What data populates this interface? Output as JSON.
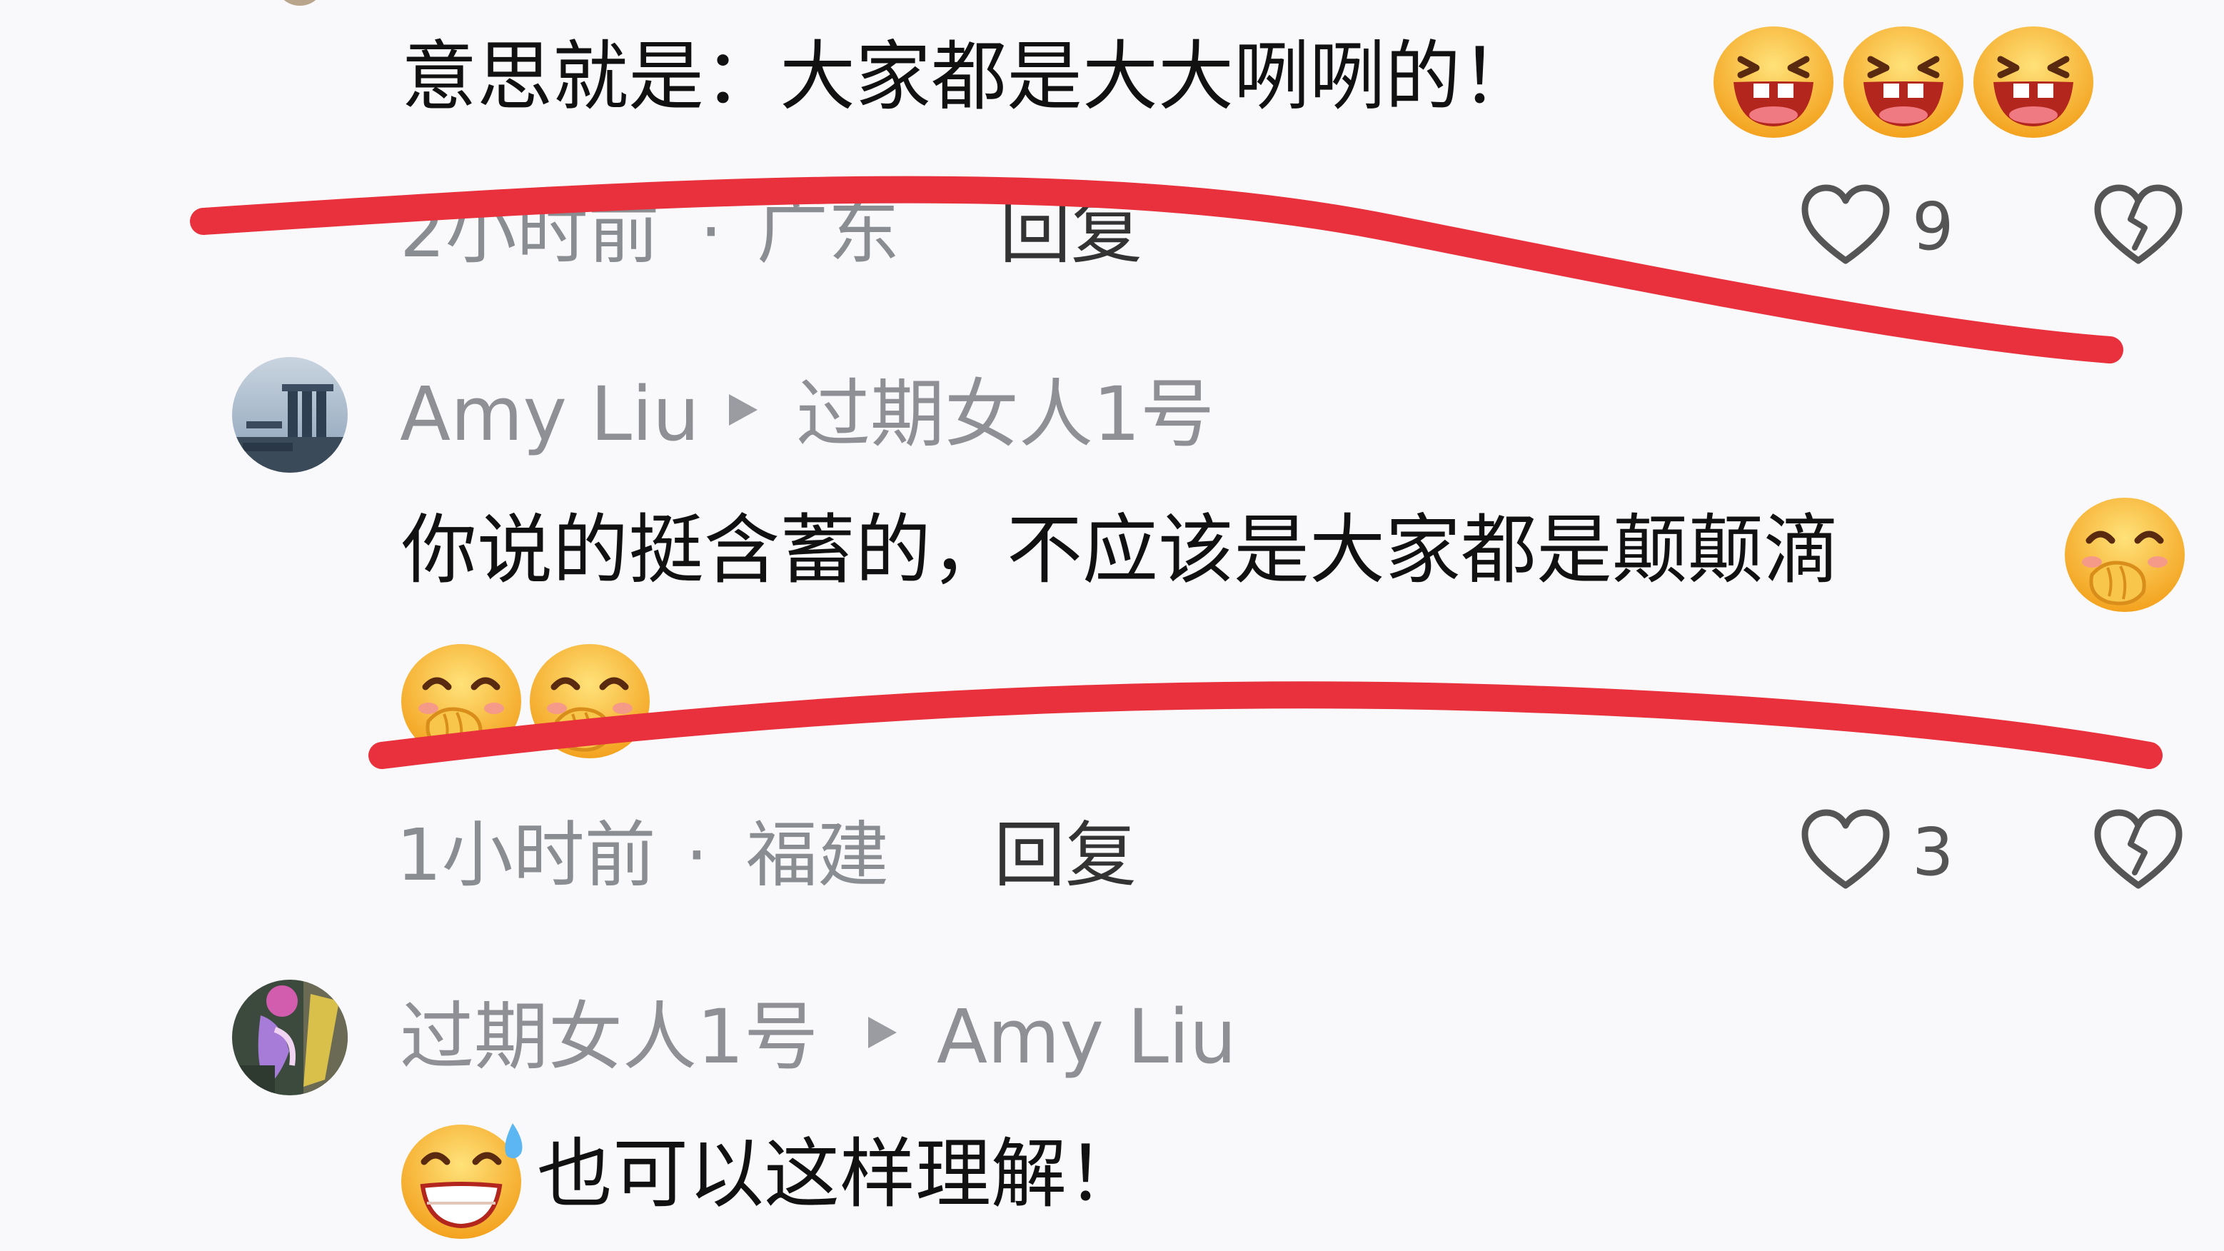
{
  "comments": [
    {
      "text": "意思就是：大家都是大大咧咧的！",
      "emojis": [
        "laughing-emoji",
        "laughing-emoji",
        "laughing-emoji"
      ],
      "time": "2小时前",
      "location": "广东",
      "reply_label": "回复",
      "likes": "9"
    },
    {
      "author": "Amy Liu",
      "reply_to": "过期女人1号",
      "text": "你说的挺含蓄的，不应该是大家都是颠颠滴",
      "emojis": [
        "cover-mouth-emoji",
        "cover-mouth-emoji",
        "cover-mouth-emoji"
      ],
      "time": "1小时前",
      "location": "福建",
      "reply_label": "回复",
      "likes": "3"
    },
    {
      "author": "过期女人1号",
      "reply_to": "Amy Liu",
      "text": "也可以这样理解！",
      "emojis": [
        "grin-sweat-emoji"
      ]
    }
  ],
  "separator": "·",
  "colors": {
    "background": "#f9f9fb",
    "annotation_red": "#e8313c",
    "meta_gray": "#8a8d92",
    "text_dark": "#111111"
  }
}
